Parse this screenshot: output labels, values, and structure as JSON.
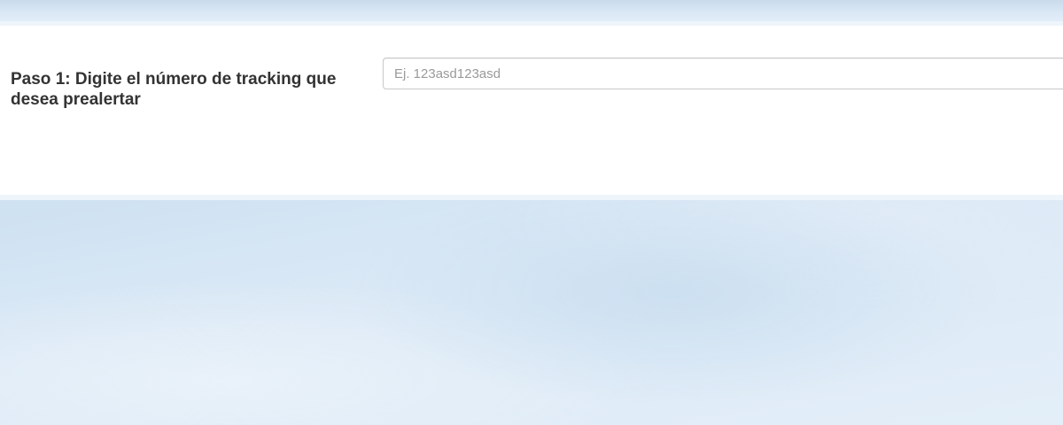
{
  "form": {
    "step1_label": "Paso 1: Digite el número de tracking que desea prealertar",
    "tracking_input": {
      "value": "",
      "placeholder": "Ej. 123asd123asd"
    }
  },
  "colors": {
    "panel_background": "#ffffff",
    "page_background": "#d6e6f4",
    "label_text": "#333333"
  }
}
